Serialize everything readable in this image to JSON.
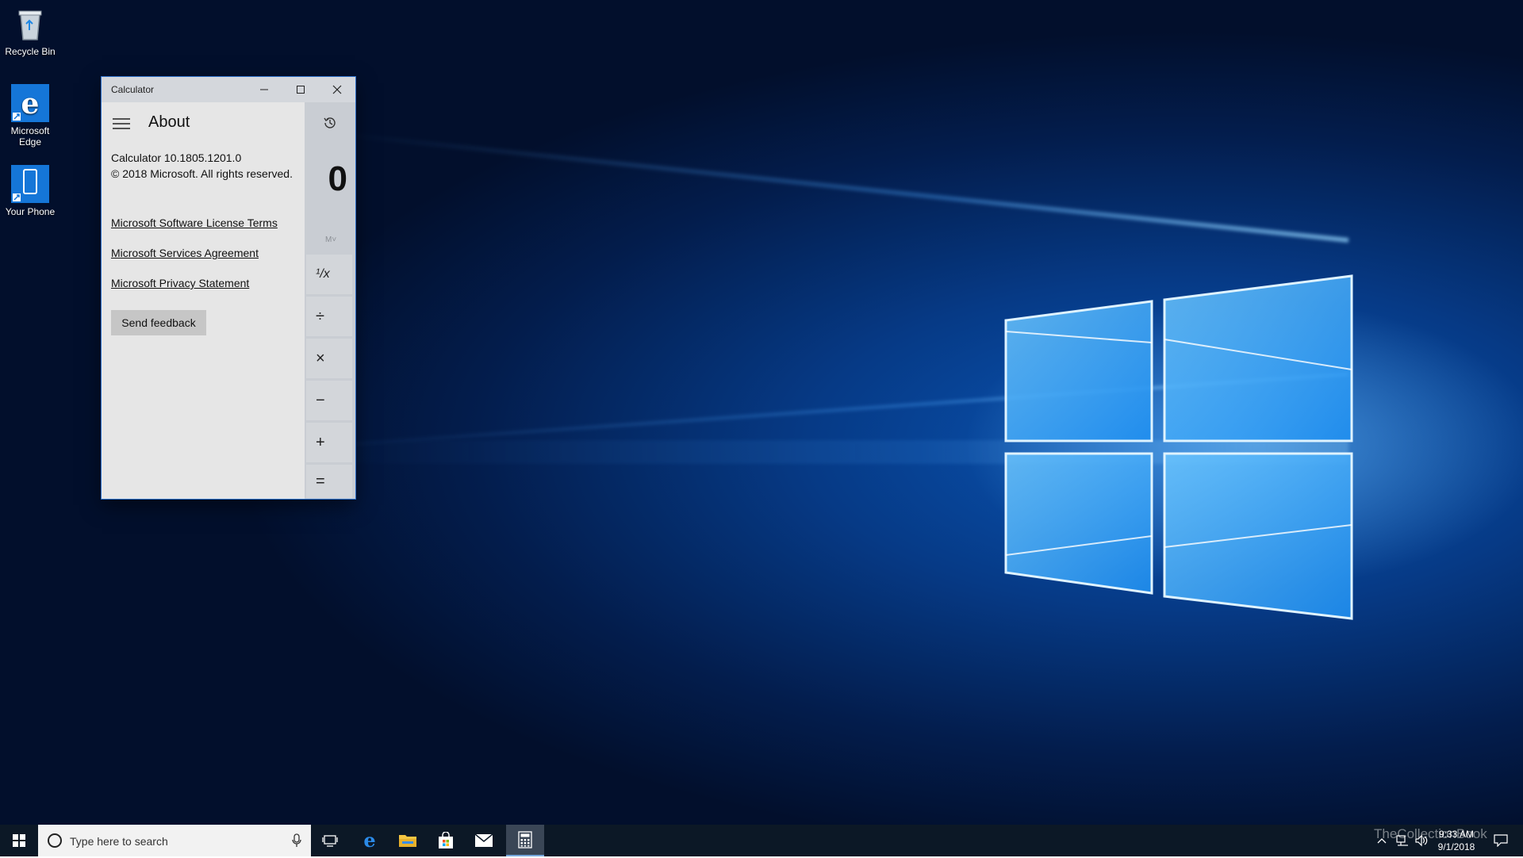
{
  "desktop": {
    "icons": [
      {
        "label": "Recycle Bin"
      },
      {
        "label": "Microsoft Edge"
      },
      {
        "label": "Your Phone"
      }
    ]
  },
  "calculator": {
    "title": "Calculator",
    "controls": {
      "minimize": "–",
      "maximize": "□",
      "close": "✕"
    },
    "about": {
      "heading": "About",
      "version": "Calculator 10.1805.1201.0",
      "copyright": "© 2018 Microsoft. All rights reserved.",
      "links": [
        "Microsoft Software License Terms",
        "Microsoft Services Agreement",
        "Microsoft Privacy Statement"
      ],
      "feedback_label": "Send feedback"
    },
    "display": {
      "value": "0",
      "memory_indicator": "M˅"
    },
    "operators": [
      "¹/x",
      "÷",
      "×",
      "−",
      "+",
      "="
    ]
  },
  "taskbar": {
    "search_placeholder": "Type here to search",
    "apps": [
      "task-view",
      "edge",
      "file-explorer",
      "store",
      "mail",
      "calculator"
    ],
    "clock": {
      "time": "9:33 AM",
      "date": "9/1/2018"
    }
  },
  "watermark": "TheCollectionBook",
  "colors": {
    "accent": "#0078d7",
    "taskbar": "#0c1826",
    "calc_bg": "#e6e6e6",
    "calc_titlebar": "#d4d7dc"
  }
}
